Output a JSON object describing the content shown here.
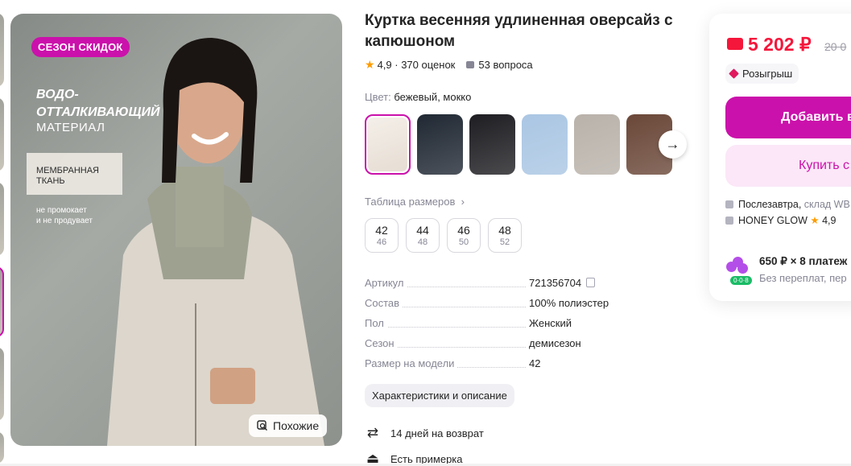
{
  "photo": {
    "sale_badge": "СЕЗОН СКИДОК",
    "headline_italic": "ВОДО-\nОТТАЛКИВАЮЩИЙ",
    "headline_2": "МАТЕРИАЛ",
    "box_text": "МЕМБРАННАЯ\nТКАНЬ",
    "small_text": "не промокает\nи не продувает",
    "similar_label": "Похожие"
  },
  "product": {
    "title": "Куртка весенняя удлиненная оверсайз с капюшоном",
    "rating": "4,9",
    "reviews": "· 370 оценок",
    "questions": "53 вопроса",
    "color_label": "Цвет:",
    "color_value": "бежевый, мокко",
    "swatch_colors": [
      "#e6ddd3",
      "#202833",
      "#1e1e22",
      "#aac6e3",
      "#b9b2aa",
      "#6a4738"
    ],
    "size_table": "Таблица размеров",
    "sizes": [
      {
        "ru": "42",
        "intl": "46"
      },
      {
        "ru": "44",
        "intl": "48"
      },
      {
        "ru": "46",
        "intl": "50"
      },
      {
        "ru": "48",
        "intl": "52"
      }
    ],
    "specs": [
      {
        "k": "Артикул",
        "v": "721356704"
      },
      {
        "k": "Состав",
        "v": "100% полиэстер"
      },
      {
        "k": "Пол",
        "v": "Женский"
      },
      {
        "k": "Сезон",
        "v": "демисезон"
      },
      {
        "k": "Размер на модели",
        "v": "42"
      }
    ],
    "chars_button": "Характеристики и описание",
    "return_text": "14 дней на возврат",
    "fitting_text": "Есть примерка"
  },
  "card": {
    "price": "5 202 ₽",
    "old_price": "20 0",
    "raffle": "Розыгрыш",
    "add_button": "Добавить в",
    "buy_button": "Купить с",
    "delivery": "Послезавтра,",
    "warehouse": "склад WB",
    "shop_name": "HONEY GLOW",
    "shop_rating": "4,9",
    "installment_tag": "0·0·8",
    "installment_main": "650 ₽ × 8 платеж",
    "installment_sub": "Без переплат, пер"
  },
  "colors": {
    "accent": "#cb11ab",
    "price_red": "#f5163b",
    "muted": "#868695",
    "star": "#ff9d00"
  }
}
